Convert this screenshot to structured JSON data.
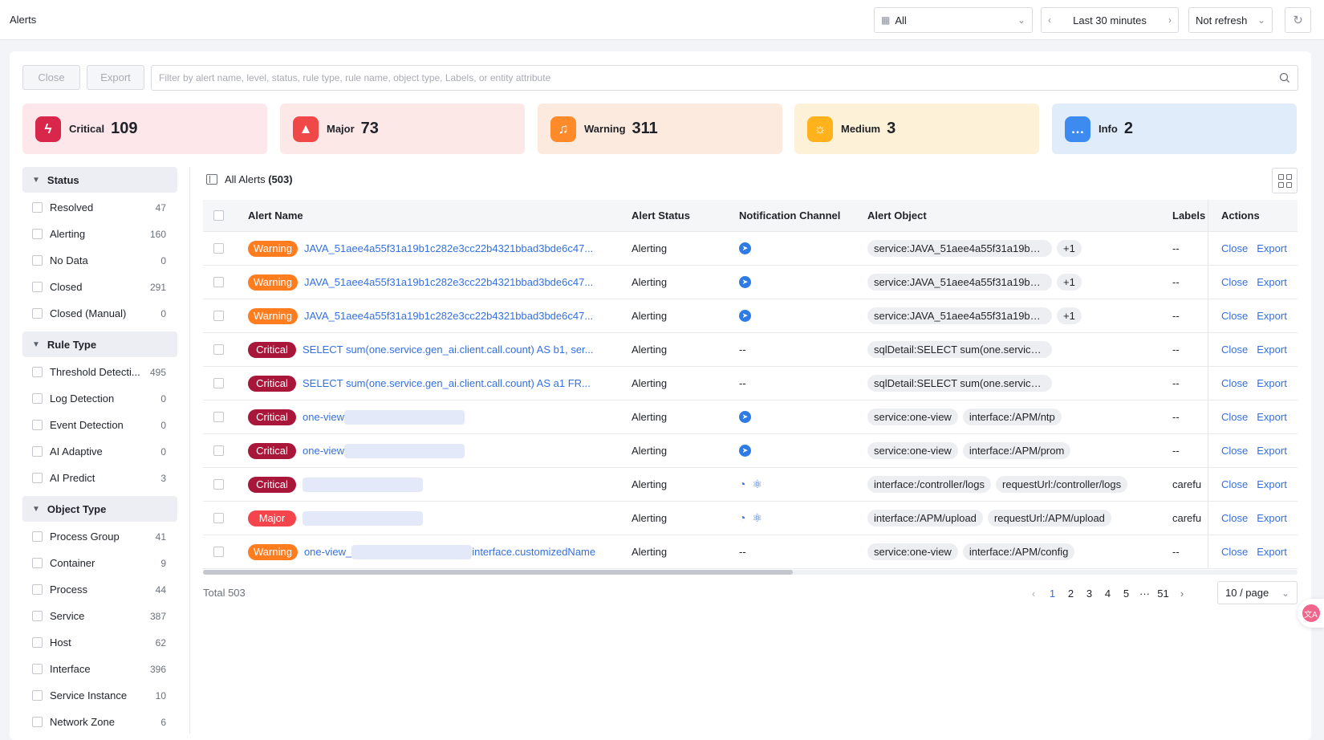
{
  "header": {
    "title": "Alerts",
    "scope": "All",
    "time_range": "Last 30 minutes",
    "refresh": "Not refresh"
  },
  "toolbar": {
    "close_label": "Close",
    "export_label": "Export",
    "search_placeholder": "Filter by alert name, level, status, rule type, rule name, object type, Labels, or entity attribute"
  },
  "levels": [
    {
      "label": "Critical",
      "count": "109",
      "bg": "#fde7ea",
      "icon_bg": "#d8274a",
      "icon": "lightning-icon"
    },
    {
      "label": "Major",
      "count": "73",
      "bg": "#fde8e8",
      "icon_bg": "#f04848",
      "icon": "alert-triangle-icon"
    },
    {
      "label": "Warning",
      "count": "311",
      "bg": "#fdeadf",
      "icon_bg": "#ff8a2a",
      "icon": "bell-icon"
    },
    {
      "label": "Medium",
      "count": "3",
      "bg": "#fdf1d8",
      "icon_bg": "#ffb21c",
      "icon": "siren-icon"
    },
    {
      "label": "Info",
      "count": "2",
      "bg": "#e1ecfb",
      "icon_bg": "#3d8bf0",
      "icon": "chat-icon"
    }
  ],
  "sidebar": {
    "status": {
      "title": "Status",
      "items": [
        {
          "name": "Resolved",
          "count": "47"
        },
        {
          "name": "Alerting",
          "count": "160"
        },
        {
          "name": "No Data",
          "count": "0"
        },
        {
          "name": "Closed",
          "count": "291"
        },
        {
          "name": "Closed (Manual)",
          "count": "0"
        }
      ]
    },
    "rule_type": {
      "title": "Rule Type",
      "items": [
        {
          "name": "Threshold Detecti...",
          "count": "495"
        },
        {
          "name": "Log Detection",
          "count": "0"
        },
        {
          "name": "Event Detection",
          "count": "0"
        },
        {
          "name": "AI Adaptive",
          "count": "0"
        },
        {
          "name": "AI Predict",
          "count": "3"
        }
      ]
    },
    "object_type": {
      "title": "Object Type",
      "items": [
        {
          "name": "Process Group",
          "count": "41"
        },
        {
          "name": "Container",
          "count": "9"
        },
        {
          "name": "Process",
          "count": "44"
        },
        {
          "name": "Service",
          "count": "387"
        },
        {
          "name": "Host",
          "count": "62"
        },
        {
          "name": "Interface",
          "count": "396"
        },
        {
          "name": "Service Instance",
          "count": "10"
        },
        {
          "name": "Network Zone",
          "count": "6"
        }
      ]
    }
  },
  "main": {
    "all_alerts_label": "All Alerts",
    "all_alerts_count": "(503)",
    "columns": [
      "Alert Name",
      "Alert Status",
      "Notification Channel",
      "Alert Object",
      "Labels",
      "Actions"
    ],
    "rows": [
      {
        "level": "Warning",
        "name": "JAVA_51aee4a55f31a19b1c282e3cc22b4321bbad3bde6c47...",
        "status": "Alerting",
        "channel": "single",
        "objects": [
          "service:JAVA_51aee4a55f31a19b1c..."
        ],
        "plus": "+1",
        "labels": "--"
      },
      {
        "level": "Warning",
        "name": "JAVA_51aee4a55f31a19b1c282e3cc22b4321bbad3bde6c47...",
        "status": "Alerting",
        "channel": "single",
        "objects": [
          "service:JAVA_51aee4a55f31a19b1c..."
        ],
        "plus": "+1",
        "labels": "--"
      },
      {
        "level": "Warning",
        "name": "JAVA_51aee4a55f31a19b1c282e3cc22b4321bbad3bde6c47...",
        "status": "Alerting",
        "channel": "single",
        "objects": [
          "service:JAVA_51aee4a55f31a19b1c..."
        ],
        "plus": "+1",
        "labels": "--"
      },
      {
        "level": "Critical",
        "name": "SELECT sum(one.service.gen_ai.client.call.count) AS b1, ser...",
        "status": "Alerting",
        "channel": "--",
        "objects": [
          "sqlDetail:SELECT sum(one.service...."
        ],
        "plus": "",
        "labels": "--"
      },
      {
        "level": "Critical",
        "name": "SELECT sum(one.service.gen_ai.client.call.count) AS a1 FR...",
        "status": "Alerting",
        "channel": "--",
        "objects": [
          "sqlDetail:SELECT sum(one.service...."
        ],
        "plus": "",
        "labels": "--"
      },
      {
        "level": "Critical",
        "name": "one-view",
        "status": "Alerting",
        "channel": "single",
        "objects": [
          "service:one-view",
          "interface:/APM/ntp"
        ],
        "plus": "",
        "labels": "--",
        "blur": true
      },
      {
        "level": "Critical",
        "name": "one-view",
        "status": "Alerting",
        "channel": "single",
        "objects": [
          "service:one-view",
          "interface:/APM/prom"
        ],
        "plus": "",
        "labels": "--",
        "blur": true
      },
      {
        "level": "Critical",
        "name": "",
        "status": "Alerting",
        "channel": "double",
        "objects": [
          "interface:/controller/logs",
          "requestUrl:/controller/logs"
        ],
        "plus": "",
        "labels": "carefu",
        "blur": true
      },
      {
        "level": "Major",
        "name": "",
        "status": "Alerting",
        "channel": "double",
        "objects": [
          "interface:/APM/upload",
          "requestUrl:/APM/upload"
        ],
        "plus": "",
        "labels": "carefu",
        "blur": true
      },
      {
        "level": "Warning",
        "name": "one-view_",
        "name_suffix": "interface.customizedName",
        "status": "Alerting",
        "channel": "--",
        "objects": [
          "service:one-view",
          "interface:/APM/config"
        ],
        "plus": "",
        "labels": "--",
        "blur": true
      }
    ],
    "actions": {
      "close": "Close",
      "export": "Export"
    }
  },
  "footer": {
    "total": "Total 503",
    "pages": [
      "1",
      "2",
      "3",
      "4",
      "5",
      "···",
      "51"
    ],
    "current_page": "1",
    "page_size": "10 / page"
  },
  "colors": {
    "accent": "#3470e0",
    "warning": "#ff7d1f",
    "critical": "#a8173a",
    "major": "#f5454c"
  }
}
